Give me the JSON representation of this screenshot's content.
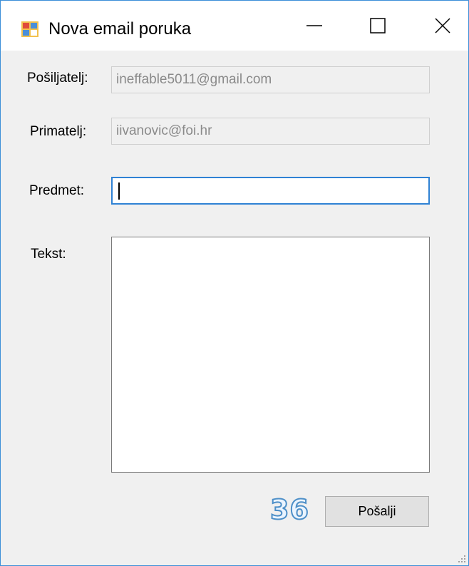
{
  "window": {
    "title": "Nova email poruka"
  },
  "titlebar": {
    "icon": "winforms-app-icon",
    "minimize_icon": "minimize-icon",
    "maximize_icon": "maximize-icon",
    "close_icon": "close-icon"
  },
  "form": {
    "sender_label": "Pošiljatelj:",
    "sender_value": "ineffable5011@gmail.com",
    "recipient_label": "Primatelj:",
    "recipient_value": "iivanovic@foi.hr",
    "subject_label": "Predmet:",
    "subject_value": "",
    "body_label": "Tekst:",
    "body_value": ""
  },
  "footer": {
    "counter": "36",
    "send_label": "Pošalji"
  },
  "colors": {
    "window_border": "#3c8fd8",
    "focus_border": "#2f82d4",
    "counter_outline": "#4d8fc8"
  }
}
